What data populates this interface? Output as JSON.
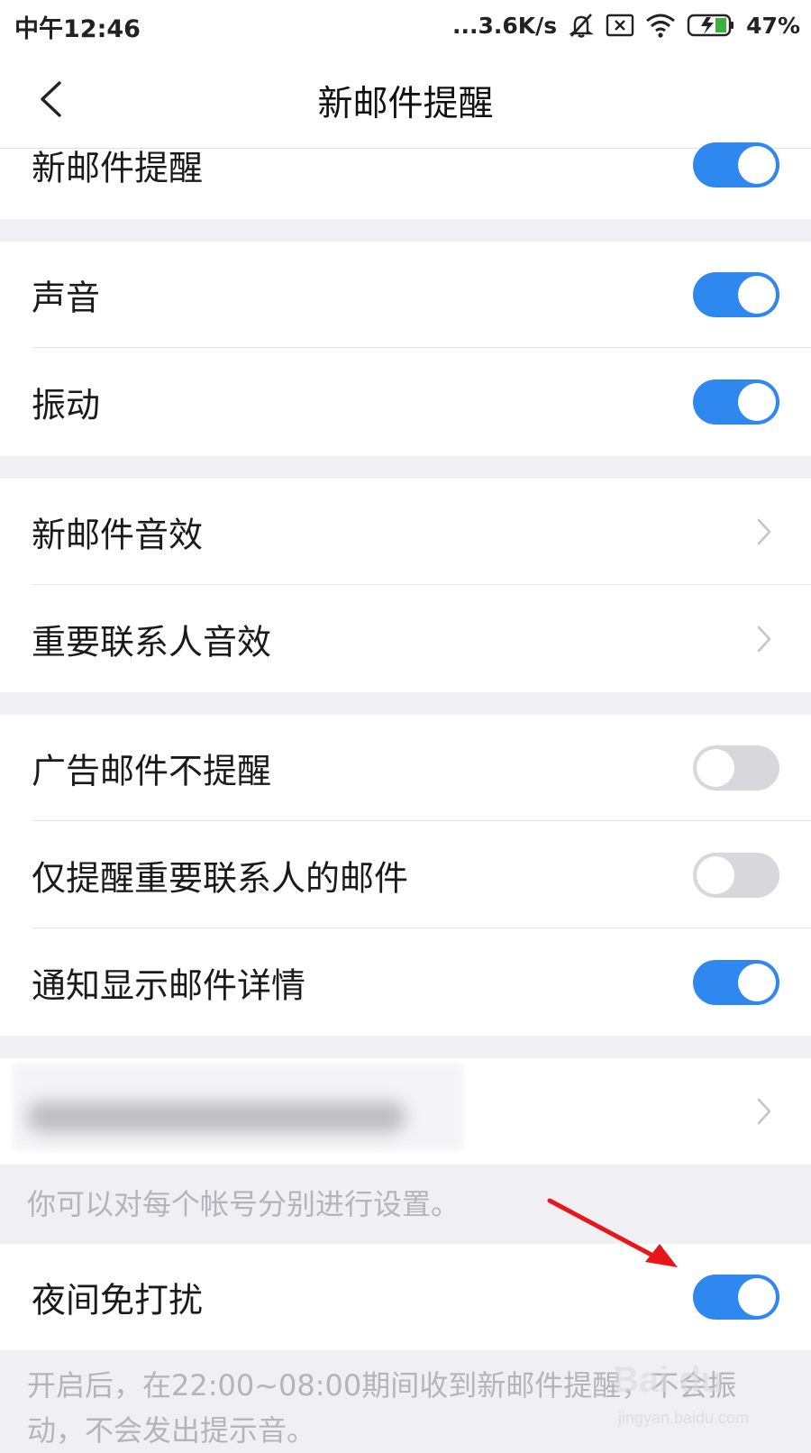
{
  "status_bar": {
    "time": "中午12:46",
    "net_speed": "...3.6K/s",
    "battery": "47%"
  },
  "nav": {
    "title": "新邮件提醒"
  },
  "rows": {
    "new_mail_alert": {
      "label": "新邮件提醒",
      "on": true
    },
    "sound": {
      "label": "声音",
      "on": true
    },
    "vibrate": {
      "label": "振动",
      "on": true
    },
    "new_mail_sound": {
      "label": "新邮件音效"
    },
    "important_contact_sound": {
      "label": "重要联系人音效"
    },
    "no_ad_mail_alert": {
      "label": "广告邮件不提醒",
      "on": false
    },
    "only_important_contacts": {
      "label": "仅提醒重要联系人的邮件",
      "on": false
    },
    "show_mail_details": {
      "label": "通知显示邮件详情",
      "on": true
    },
    "night_dnd": {
      "label": "夜间免打扰",
      "on": true
    }
  },
  "hints": {
    "per_account": "你可以对每个帐号分别进行设置。",
    "night_dnd_line1": "开启后，在22:00~08:00期间收到新邮件提醒，不会振",
    "night_dnd_line2": "动，不会发出提示音。"
  },
  "watermark": {
    "brand": "Bai du",
    "site": "jingyan.baidu.com"
  },
  "colors": {
    "toggle_on": "#2f87f0",
    "toggle_off": "#d7d7dc",
    "annotation_arrow": "#e8161b"
  },
  "icons": {
    "back": "chevron-left-icon",
    "row_arrow": "chevron-right-icon",
    "signal": "dots-icon",
    "mute": "bell-off-icon",
    "sim": "sim-x-icon",
    "wifi": "wifi-icon",
    "battery": "battery-charging-icon"
  }
}
